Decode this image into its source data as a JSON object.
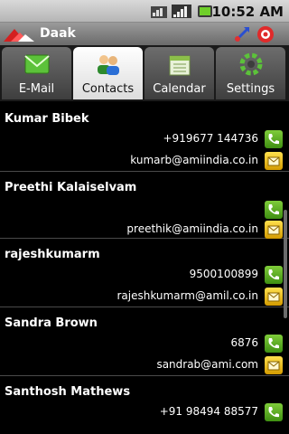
{
  "status_bar": {
    "time": "10:52 AM",
    "icons": [
      "wifi-icon",
      "signal-icon",
      "battery-icon"
    ]
  },
  "app": {
    "title": "Daak",
    "icons": [
      "sync-icon",
      "exit-icon"
    ]
  },
  "tabs": [
    {
      "label": "E-Mail",
      "icon": "email-icon",
      "selected": false
    },
    {
      "label": "Contacts",
      "icon": "contacts-icon",
      "selected": true
    },
    {
      "label": "Calendar",
      "icon": "calendar-icon",
      "selected": false
    },
    {
      "label": "Settings",
      "icon": "settings-icon",
      "selected": false
    }
  ],
  "contacts": [
    {
      "name": "Kumar Bibek",
      "phone": "+919677 144736",
      "email": "kumarb@amiindia.co.in"
    },
    {
      "name": "Preethi  Kalaiselvam",
      "phone": "",
      "email": "preethik@amiindia.co.in"
    },
    {
      "name": "rajeshkumarm",
      "phone": "9500100899",
      "email": "rajeshkumarm@amil.co.in"
    },
    {
      "name": "Sandra Brown",
      "phone": "6876",
      "email": "sandrab@ami.com"
    },
    {
      "name": "Santhosh Mathews",
      "phone": "+91 98494 88577",
      "email": ""
    }
  ],
  "colors": {
    "call_button": "#5fb026",
    "mail_button": "#f0c020",
    "selected_tab": "#ffffff"
  }
}
